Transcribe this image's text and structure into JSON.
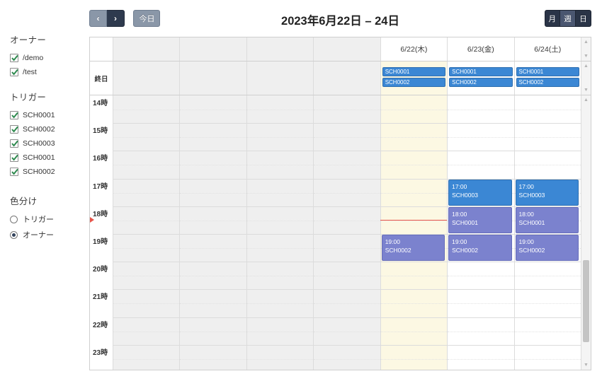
{
  "sidebar": {
    "owner_heading": "オーナー",
    "owners": [
      {
        "label": "/demo",
        "checked": true
      },
      {
        "label": "/test",
        "checked": true
      }
    ],
    "trigger_heading": "トリガー",
    "triggers": [
      {
        "label": "SCH0001",
        "checked": true
      },
      {
        "label": "SCH0002",
        "checked": true
      },
      {
        "label": "SCH0003",
        "checked": true
      },
      {
        "label": "SCH0001",
        "checked": true
      },
      {
        "label": "SCH0002",
        "checked": true
      }
    ],
    "colorby_heading": "色分け",
    "colorby_options": [
      {
        "label": "トリガー",
        "selected": false
      },
      {
        "label": "オーナー",
        "selected": true
      }
    ]
  },
  "toolbar": {
    "prev_label": "‹",
    "next_label": "›",
    "today_label": "今日",
    "views": [
      {
        "label": "月",
        "active": false
      },
      {
        "label": "週",
        "active": true
      },
      {
        "label": "日",
        "active": false
      }
    ]
  },
  "calendar": {
    "title": "2023年6月22日 – 24日",
    "allday_label": "終日",
    "columns": [
      {
        "label": "",
        "state": "past"
      },
      {
        "label": "",
        "state": "past"
      },
      {
        "label": "",
        "state": "past"
      },
      {
        "label": "",
        "state": "past"
      },
      {
        "label": "6/22(木)",
        "state": "today"
      },
      {
        "label": "6/23(金)",
        "state": "future"
      },
      {
        "label": "6/24(土)",
        "state": "future"
      }
    ],
    "hours": [
      "14時",
      "15時",
      "16時",
      "17時",
      "18時",
      "19時",
      "20時",
      "21時",
      "22時",
      "23時"
    ],
    "allday_events": [
      {
        "col": 4,
        "labels": [
          "SCH0001",
          "SCH0002"
        ]
      },
      {
        "col": 5,
        "labels": [
          "SCH0001",
          "SCH0002"
        ]
      },
      {
        "col": 6,
        "labels": [
          "SCH0001",
          "SCH0002"
        ]
      }
    ],
    "events": [
      {
        "col": 4,
        "time": "19:00",
        "name": "SCH0002",
        "hour": 19,
        "duration": 1,
        "color": "purple"
      },
      {
        "col": 5,
        "time": "17:00",
        "name": "SCH0003",
        "hour": 17,
        "duration": 1,
        "color": "blue"
      },
      {
        "col": 5,
        "time": "18:00",
        "name": "SCH0001",
        "hour": 18,
        "duration": 1,
        "color": "purple"
      },
      {
        "col": 5,
        "time": "19:00",
        "name": "SCH0002",
        "hour": 19,
        "duration": 1,
        "color": "purple"
      },
      {
        "col": 6,
        "time": "17:00",
        "name": "SCH0003",
        "hour": 17,
        "duration": 1,
        "color": "blue"
      },
      {
        "col": 6,
        "time": "18:00",
        "name": "SCH0001",
        "hour": 18,
        "duration": 1,
        "color": "purple"
      },
      {
        "col": 6,
        "time": "19:00",
        "name": "SCH0002",
        "hour": 19,
        "duration": 1,
        "color": "purple"
      }
    ],
    "now_marker_hour": 18.5,
    "now_marker_col": 4
  },
  "colors": {
    "event_blue": "#3b87d4",
    "event_purple": "#7b82ce",
    "today_bg": "#fcf8e3",
    "past_bg": "#efefef",
    "now_line": "#e8554a",
    "btn_navy": "#2a3447"
  }
}
